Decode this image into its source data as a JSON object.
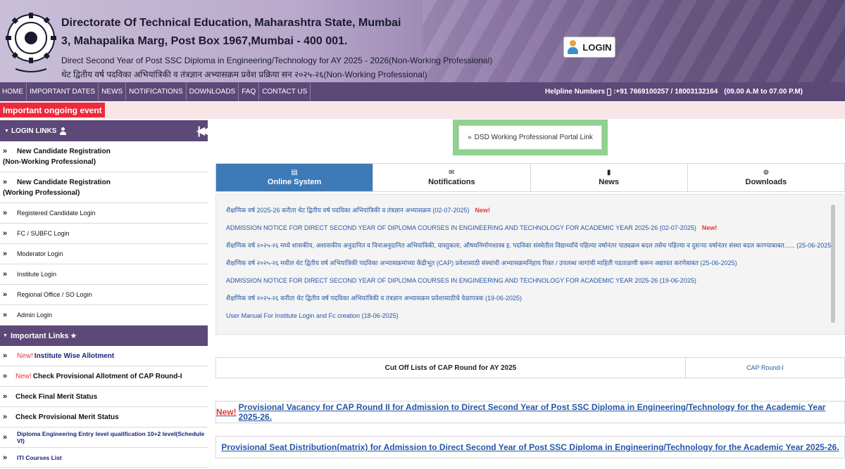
{
  "header": {
    "line1": "Directorate Of Technical Education, Maharashtra State, Mumbai",
    "line2": "3, Mahapalika Marg, Post Box 1967,Mumbai - 400 001.",
    "line3": "Direct Second Year of Post SSC Diploma in Engineering/Technology for AY 2025 - 2026(Non-Working Professional)",
    "line4": "थेट द्वितीय वर्ष पदविका अभियांत्रिकी व तंत्रज्ञान अभ्यासक्रम प्रवेश प्रक्रिया सन २०२५-२६(Non-Working Professional)",
    "login_label": "LOGIN"
  },
  "nav": {
    "items": [
      "HOME",
      "IMPORTANT DATES",
      "NEWS",
      "NOTIFICATIONS",
      "DOWNLOADS",
      "FAQ",
      "CONTACT US"
    ],
    "helpline_label": "Helpline Numbers",
    "helpline_numbers": ":+91 7669100257 / 18003132164",
    "helpline_hours": "(09.00 A.M to 07.00 P.M)"
  },
  "event": {
    "label": "Important ongoing event"
  },
  "sidebar": {
    "login_heading": "LOGIN LINKS",
    "login_links": [
      {
        "line1": "New Candidate Registration",
        "line2": "(Non-Working Professional)"
      },
      {
        "line1": "New Candidate Registration",
        "line2": "(Working Professional)"
      },
      {
        "line1": "Registered Candidate Login"
      },
      {
        "line1": "FC / SUBFC Login"
      },
      {
        "line1": "Moderator Login"
      },
      {
        "line1": "Institute Login"
      },
      {
        "line1": "Regional Office / SO Login"
      },
      {
        "line1": "Admin Login"
      }
    ],
    "important_heading": "Important Links",
    "important_links": [
      {
        "new": "New!",
        "text": "Institute Wise Allotment"
      },
      {
        "new": "New!",
        "text": "Check Provisional Allotment of CAP Round-I"
      },
      {
        "text": "Check Final Merit Status"
      },
      {
        "text": "Check Provisional Merit Status"
      },
      {
        "text": "Diploma Engineering Entry level qualification 10+2 level(Schedule VI)"
      },
      {
        "text": "ITI Courses List"
      }
    ]
  },
  "dsd": {
    "label": "DSD Working Professional Portal Link"
  },
  "tabs": [
    "Online System",
    "Notifications",
    "News",
    "Downloads"
  ],
  "notices": [
    {
      "text": "शैक्षणिक वर्ष 2025-26 करीता थेट द्वितीय वर्ष पदविका अभियांत्रिकी व तंत्रज्ञान अभ्यासक्रम (02-07-2025)",
      "new": "New!"
    },
    {
      "text": "ADMISSION NOTICE FOR DIRECT SECOND YEAR OF DIPLOMA COURSES IN ENGINEERING AND TECHNOLOGY FOR ACADEMIC YEAR 2025-26 (02-07-2025)",
      "new": "New!"
    },
    {
      "text": "शैक्षणिक वर्ष २०२५-२६ मध्ये शासकीय, अशासकीय अनुदानित व विनाअनुदानित अभियांत्रिकी, वास्तुकला, औषधनिर्माणशास्त्र इ. पदविका संस्थेतील विद्यार्थ्यांचे पहिल्या वर्षानंतर पाठ्यक्रम बदल तसेच पहिल्या व दुसऱ्या वर्षानंतर संस्था बदल करण्याबाबत...... (25-06-2025)"
    },
    {
      "text": "शैक्षणिक वर्ष २०२५-२६ मधील थेट द्वितीय वर्ष अभियांत्रिकी पदविका अभ्यासक्रमांच्या केंद्रीभूत (CAP) प्रवेशासाठी संस्थांची अभ्यासक्रमनिहाय रिक्त / उपलब्ध जागांची माहिती पडताळणी करून अद्यावत करणेबाबत (25-06-2025)"
    },
    {
      "text": "ADMISSION NOTICE FOR DIRECT SECOND YEAR OF DIPLOMA COURSES IN ENGINEERING AND TECHNOLOGY FOR ACADEMIC YEAR 2025-26 (19-06-2025)"
    },
    {
      "text": "शैक्षणिक वर्ष २०२५-२६ करीता थेट द्वितीय वर्ष पदविका अभियांत्रिकी व तंत्रज्ञान अभ्यासक्रम प्रवेशासाठीचे वेळापत्रक (19-06-2025)"
    },
    {
      "text": "User Manual For Institute Login and Fc creation (18-06-2025)"
    }
  ],
  "cutoff": {
    "label": "Cut Off Lists of CAP Round for AY 2025",
    "link": "CAP Round-I"
  },
  "banners": [
    {
      "new": "New!",
      "text": "Provisional Vacancy for CAP Round II for Admission to Direct Second Year of Post SSC Diploma in Engineering/Technology for the Academic Year 2025-26."
    },
    {
      "text": "Provisional Seat Distribution(matrix) for Admission to Direct Second Year of Post SSC Diploma in Engineering/Technology for the Academic Year 2025-26."
    }
  ]
}
